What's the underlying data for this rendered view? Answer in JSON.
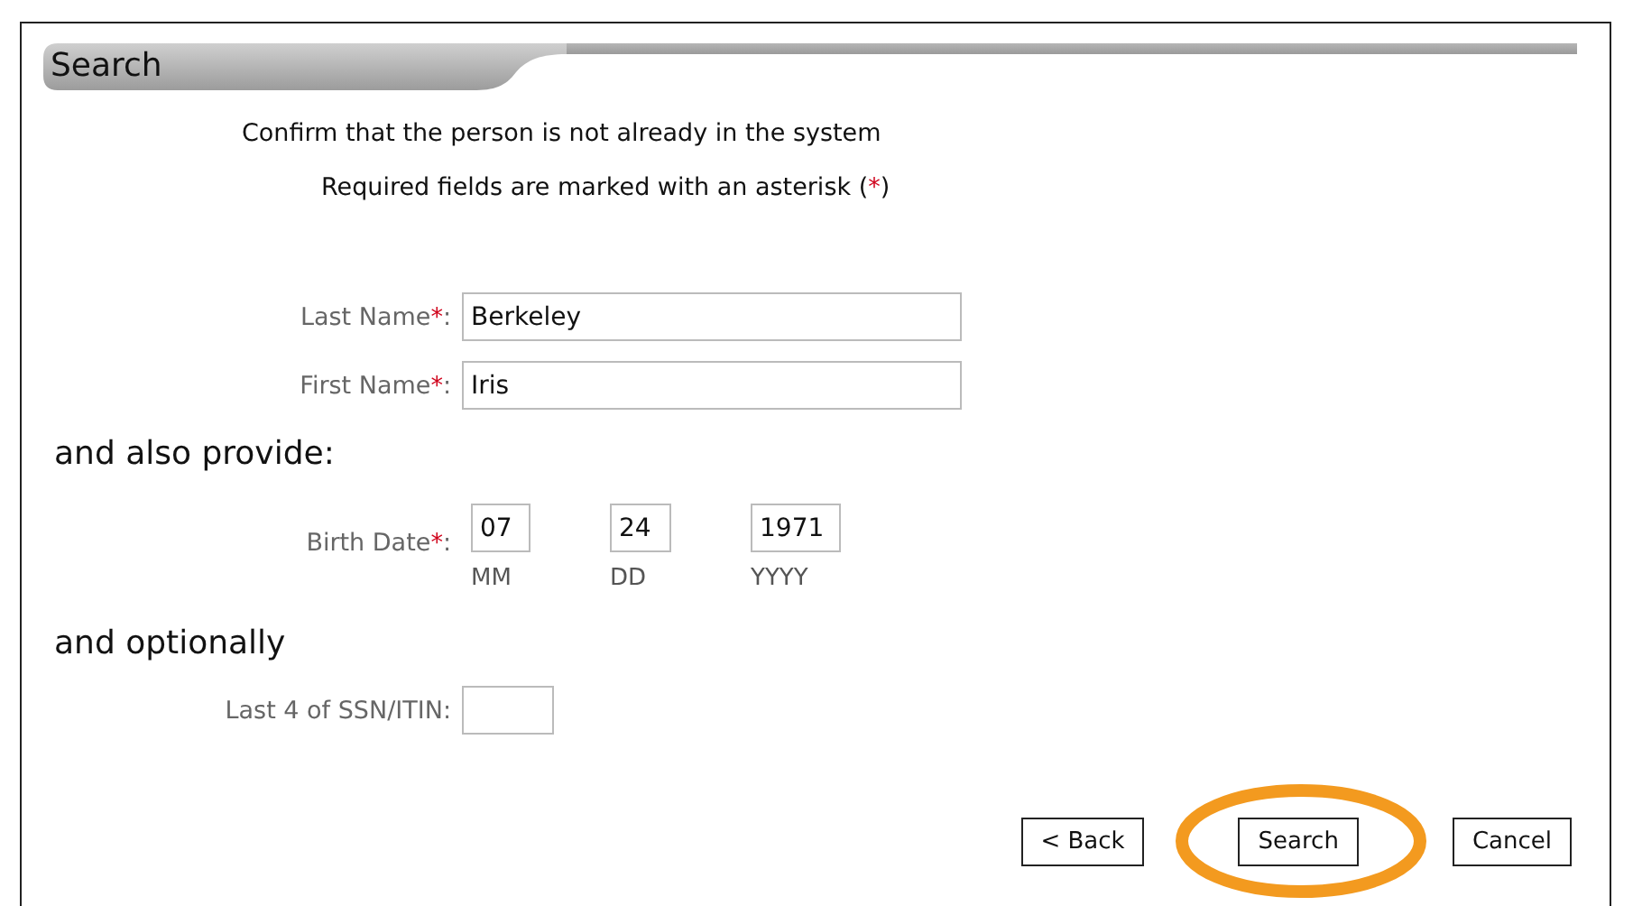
{
  "section": {
    "title": "Search"
  },
  "intro": "Confirm that the person is not already in the system",
  "required_note": {
    "before": "Required fields are marked with an asterisk (",
    "mark": "*",
    "after": ")"
  },
  "name_fields": [
    {
      "label": "Last Name",
      "mark": "*",
      "colon": ":",
      "value": "Berkeley"
    },
    {
      "label": "First Name",
      "mark": "*",
      "colon": ":",
      "value": "Iris"
    }
  ],
  "also_heading": "and also provide:",
  "birth_date": {
    "label": "Birth Date",
    "mark": "*",
    "colon": ":",
    "parts": [
      {
        "value": "07",
        "caption": "MM"
      },
      {
        "value": "24",
        "caption": "DD"
      },
      {
        "value": "1971",
        "caption": "YYYY"
      }
    ]
  },
  "optional_heading": "and optionally",
  "ssn": {
    "label": "Last 4 of SSN/ITIN:"
  },
  "buttons": [
    {
      "label": "< Back",
      "highlighted": false
    },
    {
      "label": "Search",
      "highlighted": true
    },
    {
      "label": "Cancel",
      "highlighted": false
    }
  ]
}
